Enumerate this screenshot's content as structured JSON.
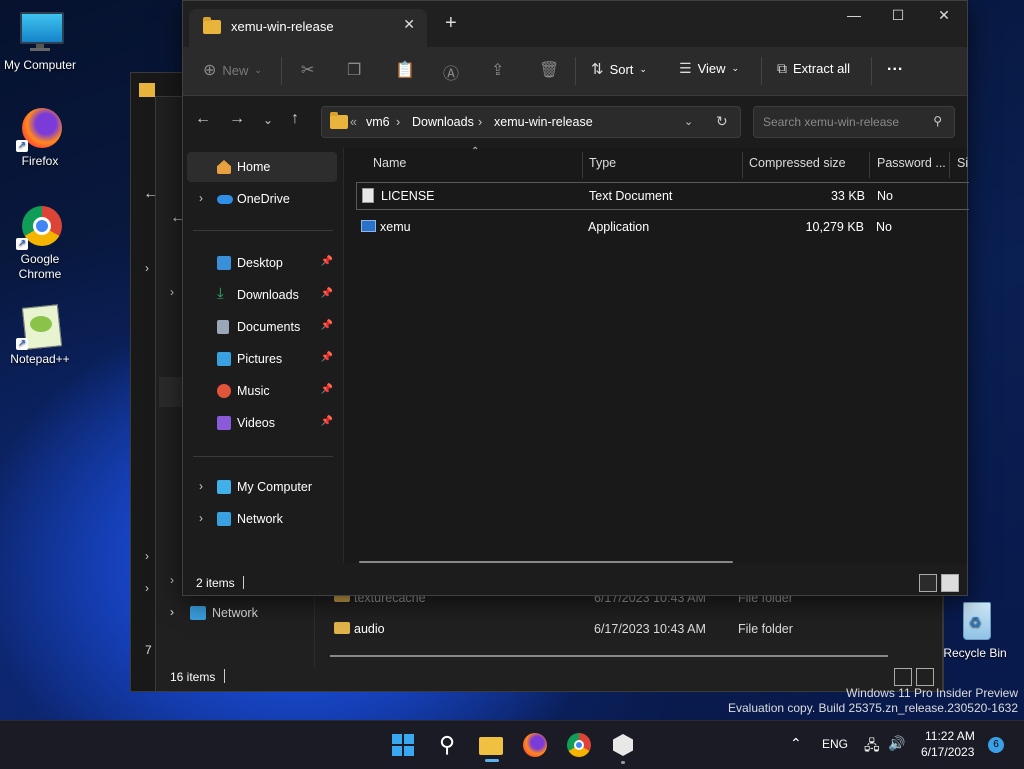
{
  "desktop": {
    "icons": [
      {
        "label": "My Computer"
      },
      {
        "label": "Firefox"
      },
      {
        "label": "Google Chrome"
      },
      {
        "label": "Notepad++"
      },
      {
        "label": "Recycle Bin"
      }
    ],
    "watermark": {
      "line1": "Windows 11 Pro Insider Preview",
      "line2": "Evaluation copy. Build 25375.zn_release.230520-1632"
    }
  },
  "back_window": {
    "rows": [
      {
        "name": "texturecache",
        "date": "6/17/2023 10:43 AM",
        "type": "File folder"
      },
      {
        "name": "audio",
        "date": "6/17/2023 10:43 AM",
        "type": "File folder"
      }
    ],
    "sidebar_network": "Network",
    "status": "16 items",
    "partial_status": "7 i"
  },
  "window": {
    "tab_title": "xemu-win-release",
    "toolbar": {
      "new_label": "New",
      "sort_label": "Sort",
      "view_label": "View",
      "extract_label": "Extract all",
      "more_label": "..."
    },
    "address": {
      "overflow": "«",
      "crumbs": [
        "vm6",
        "Downloads",
        "xemu-win-release"
      ]
    },
    "search_placeholder": "Search xemu-win-release",
    "sidebar": {
      "home": "Home",
      "onedrive": "OneDrive",
      "quick": [
        {
          "label": "Desktop",
          "color": "#3a8fd8"
        },
        {
          "label": "Downloads",
          "color": "#2fb46a"
        },
        {
          "label": "Documents",
          "color": "#9aa7b8"
        },
        {
          "label": "Pictures",
          "color": "#3aa0e0"
        },
        {
          "label": "Music",
          "color": "#e0553a"
        },
        {
          "label": "Videos",
          "color": "#8a5ad8"
        }
      ],
      "my_computer": "My Computer",
      "network": "Network"
    },
    "columns": [
      "Name",
      "Type",
      "Compressed size",
      "Password ...",
      "Si"
    ],
    "files": [
      {
        "name": "LICENSE",
        "type": "Text Document",
        "size": "33 KB",
        "password": "No"
      },
      {
        "name": "xemu",
        "type": "Application",
        "size": "10,279 KB",
        "password": "No"
      }
    ],
    "status": "2 items"
  },
  "taskbar": {
    "lang": "ENG",
    "time": "11:22 AM",
    "date": "6/17/2023",
    "notification_count": "6"
  }
}
